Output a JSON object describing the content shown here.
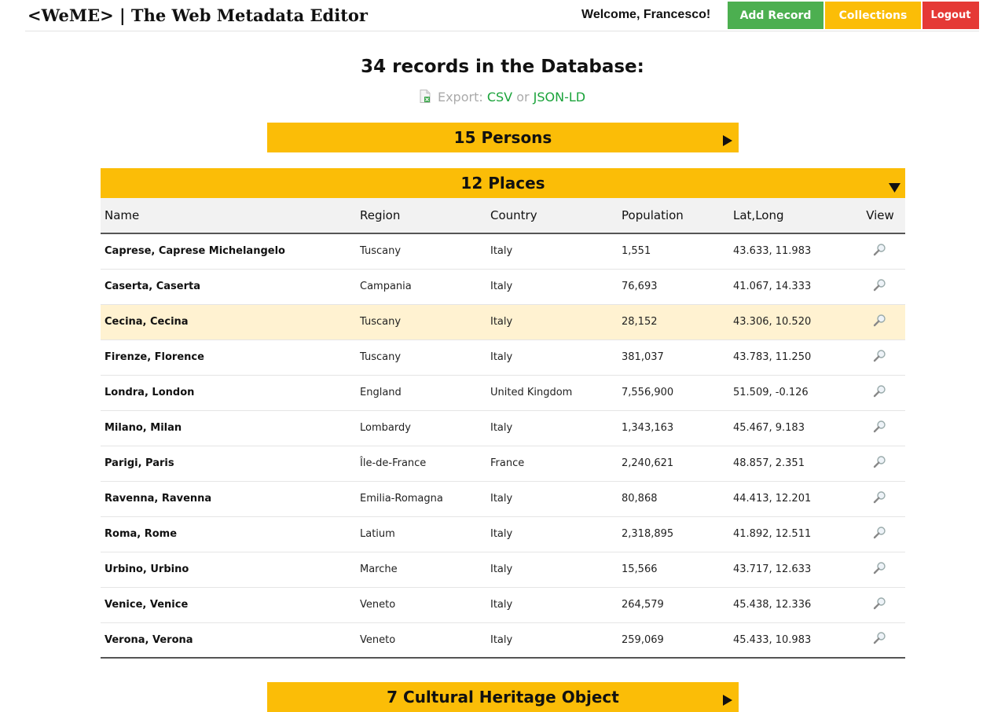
{
  "header": {
    "brand": "<WeME> | The Web Metadata Editor",
    "welcome": "Welcome, Francesco!",
    "add_record": "Add Record",
    "collections": "Collections",
    "logout": "Logout"
  },
  "summary": {
    "title": "34 records in the Database:",
    "export_label": "Export:",
    "csv": "CSV",
    "or": "or",
    "jsonld": "JSON-LD"
  },
  "categories": {
    "persons": "15 Persons",
    "places": "12 Places",
    "cho": "7 Cultural Heritage Object"
  },
  "table": {
    "columns": [
      "Name",
      "Region",
      "Country",
      "Population",
      "Lat,Long",
      "View"
    ],
    "rows": [
      {
        "name": "Caprese, Caprese Michelangelo",
        "region": "Tuscany",
        "country": "Italy",
        "population": "1,551",
        "latlong": "43.633, 11.983"
      },
      {
        "name": "Caserta, Caserta",
        "region": "Campania",
        "country": "Italy",
        "population": "76,693",
        "latlong": "41.067, 14.333"
      },
      {
        "name": "Cecina, Cecina",
        "region": "Tuscany",
        "country": "Italy",
        "population": "28,152",
        "latlong": "43.306, 10.520"
      },
      {
        "name": "Firenze, Florence",
        "region": "Tuscany",
        "country": "Italy",
        "population": "381,037",
        "latlong": "43.783, 11.250"
      },
      {
        "name": "Londra, London",
        "region": "England",
        "country": "United Kingdom",
        "population": "7,556,900",
        "latlong": "51.509, -0.126"
      },
      {
        "name": "Milano, Milan",
        "region": "Lombardy",
        "country": "Italy",
        "population": "1,343,163",
        "latlong": "45.467, 9.183"
      },
      {
        "name": "Parigi, Paris",
        "region": "Île-de-France",
        "country": "France",
        "population": "2,240,621",
        "latlong": "48.857, 2.351"
      },
      {
        "name": "Ravenna, Ravenna",
        "region": "Emilia-Romagna",
        "country": "Italy",
        "population": "80,868",
        "latlong": "44.413, 12.201"
      },
      {
        "name": "Roma, Rome",
        "region": "Latium",
        "country": "Italy",
        "population": "2,318,895",
        "latlong": "41.892, 12.511"
      },
      {
        "name": "Urbino, Urbino",
        "region": "Marche",
        "country": "Italy",
        "population": "15,566",
        "latlong": "43.717, 12.633"
      },
      {
        "name": "Venice, Venice",
        "region": "Veneto",
        "country": "Italy",
        "population": "264,579",
        "latlong": "45.438, 12.336"
      },
      {
        "name": "Verona, Verona",
        "region": "Veneto",
        "country": "Italy",
        "population": "259,069",
        "latlong": "45.433, 10.983"
      }
    ]
  },
  "colors": {
    "accent": "#fbbd07",
    "add": "#4caf50",
    "logout": "#e53935",
    "link": "#1aa33a",
    "highlight_row": "#fff2d1"
  },
  "icons": {
    "export": "spreadsheet-file-icon",
    "view": "magnifier-icon",
    "collapsed": "triangle-right-icon",
    "expanded": "triangle-down-icon"
  }
}
